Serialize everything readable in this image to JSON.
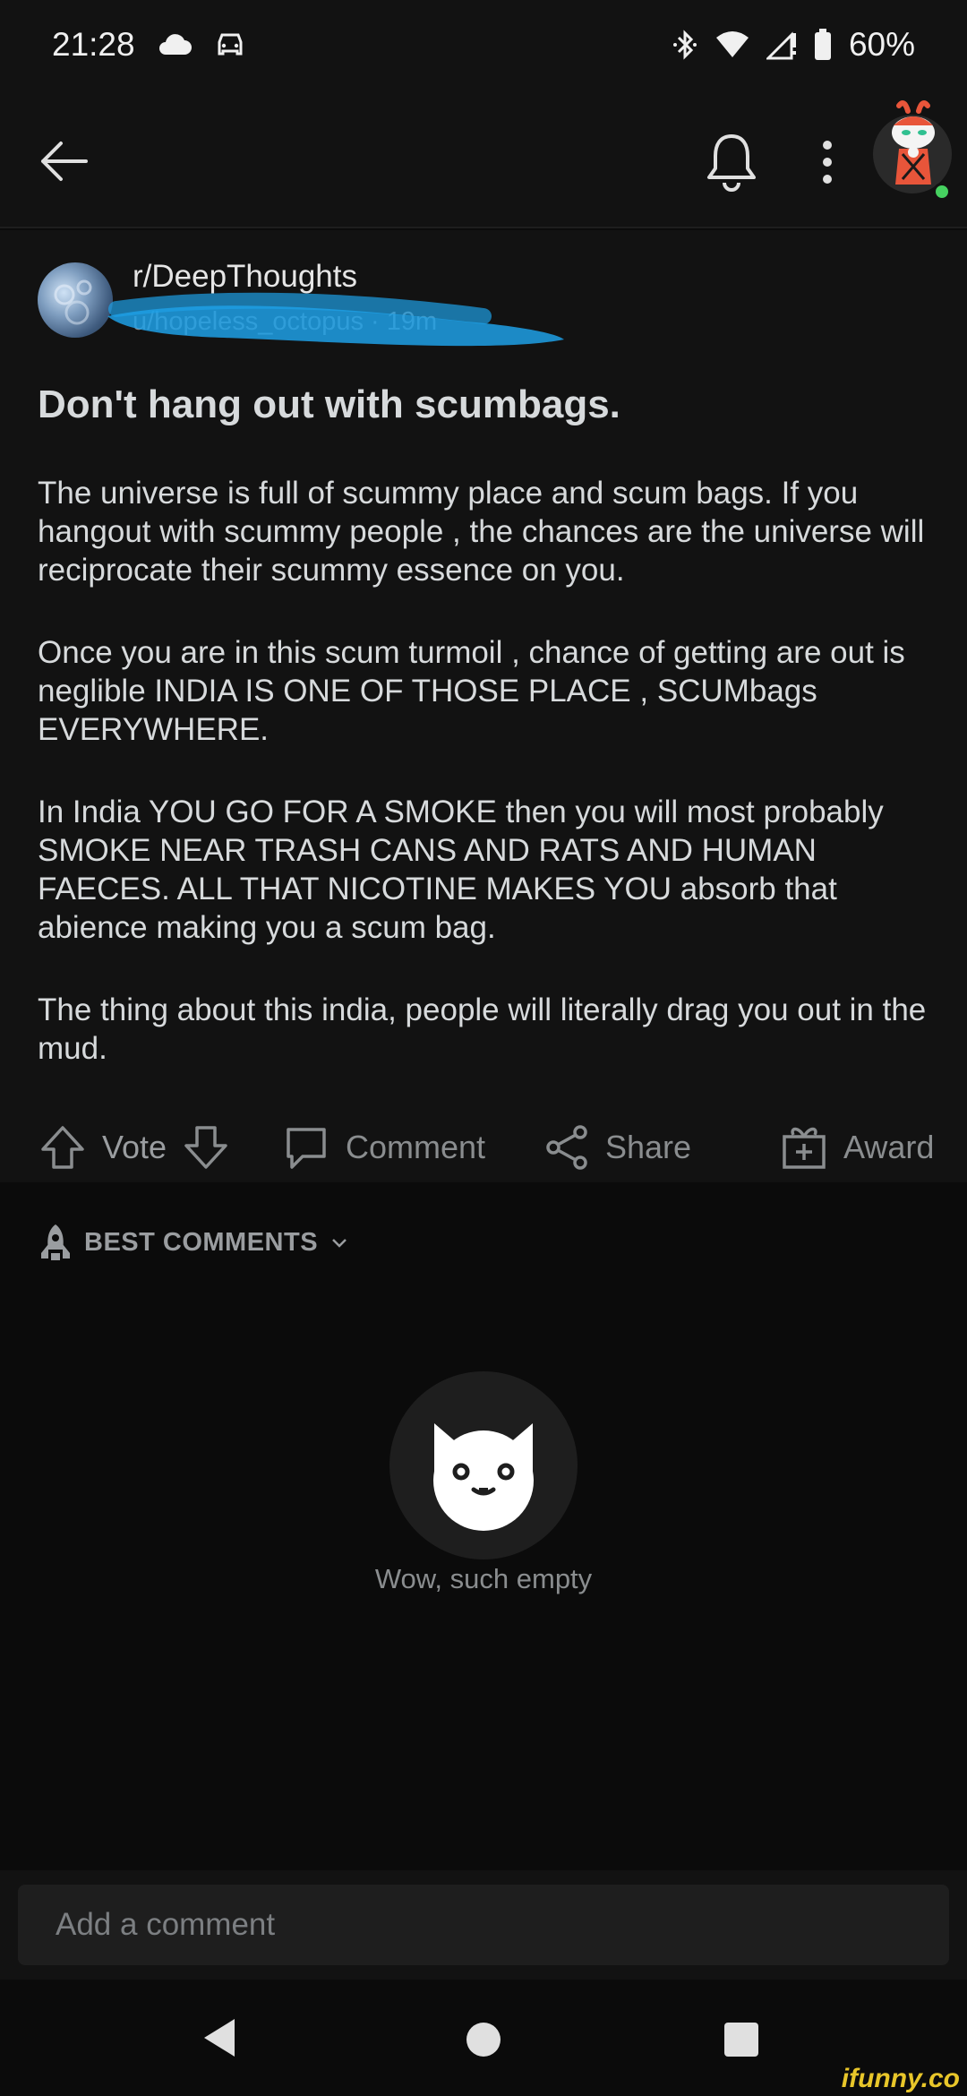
{
  "status_bar": {
    "time": "21:28",
    "battery": "60%",
    "icons": [
      "cloud-icon",
      "car-icon",
      "bluetooth-icon",
      "wifi-icon",
      "signal-icon",
      "battery-icon"
    ]
  },
  "app_bar": {
    "icons": [
      "back-arrow-icon",
      "bell-icon",
      "more-vertical-icon",
      "avatar"
    ]
  },
  "post": {
    "subreddit": "r/DeepThoughts",
    "author": "u/hopeless_octopus",
    "age": "19m",
    "title": "Don't hang out with scumbags.",
    "body": [
      "The universe is full of scummy place and scum bags. If you hangout with scummy people , the chances are the universe will reciprocate their scummy essence on you.",
      "Once you are in this scum turmoil , chance of getting are out is neglible INDIA IS ONE OF THOSE PLACE , SCUMbags EVERYWHERE.",
      "In India YOU GO FOR A SMOKE then you will most probably SMOKE NEAR TRASH CANS AND RATS AND HUMAN FAECES.  ALL THAT NICOTINE MAKES YOU absorb that abience making  you a scum bag.",
      "The thing about this india, people will literally drag you out in the mud."
    ],
    "actions": {
      "vote": "Vote",
      "comment": "Comment",
      "share": "Share",
      "award": "Award"
    }
  },
  "comments": {
    "sort_label": "BEST COMMENTS",
    "empty_text": "Wow, such empty"
  },
  "comment_input": {
    "placeholder": "Add a comment"
  },
  "watermark": "ifunny.co",
  "colors": {
    "background": "#0b0b0b",
    "surface": "#121212",
    "text": "#d7dadc",
    "muted": "#8a8d8f",
    "scribble": "#1ea0e6",
    "online": "#46d160"
  }
}
